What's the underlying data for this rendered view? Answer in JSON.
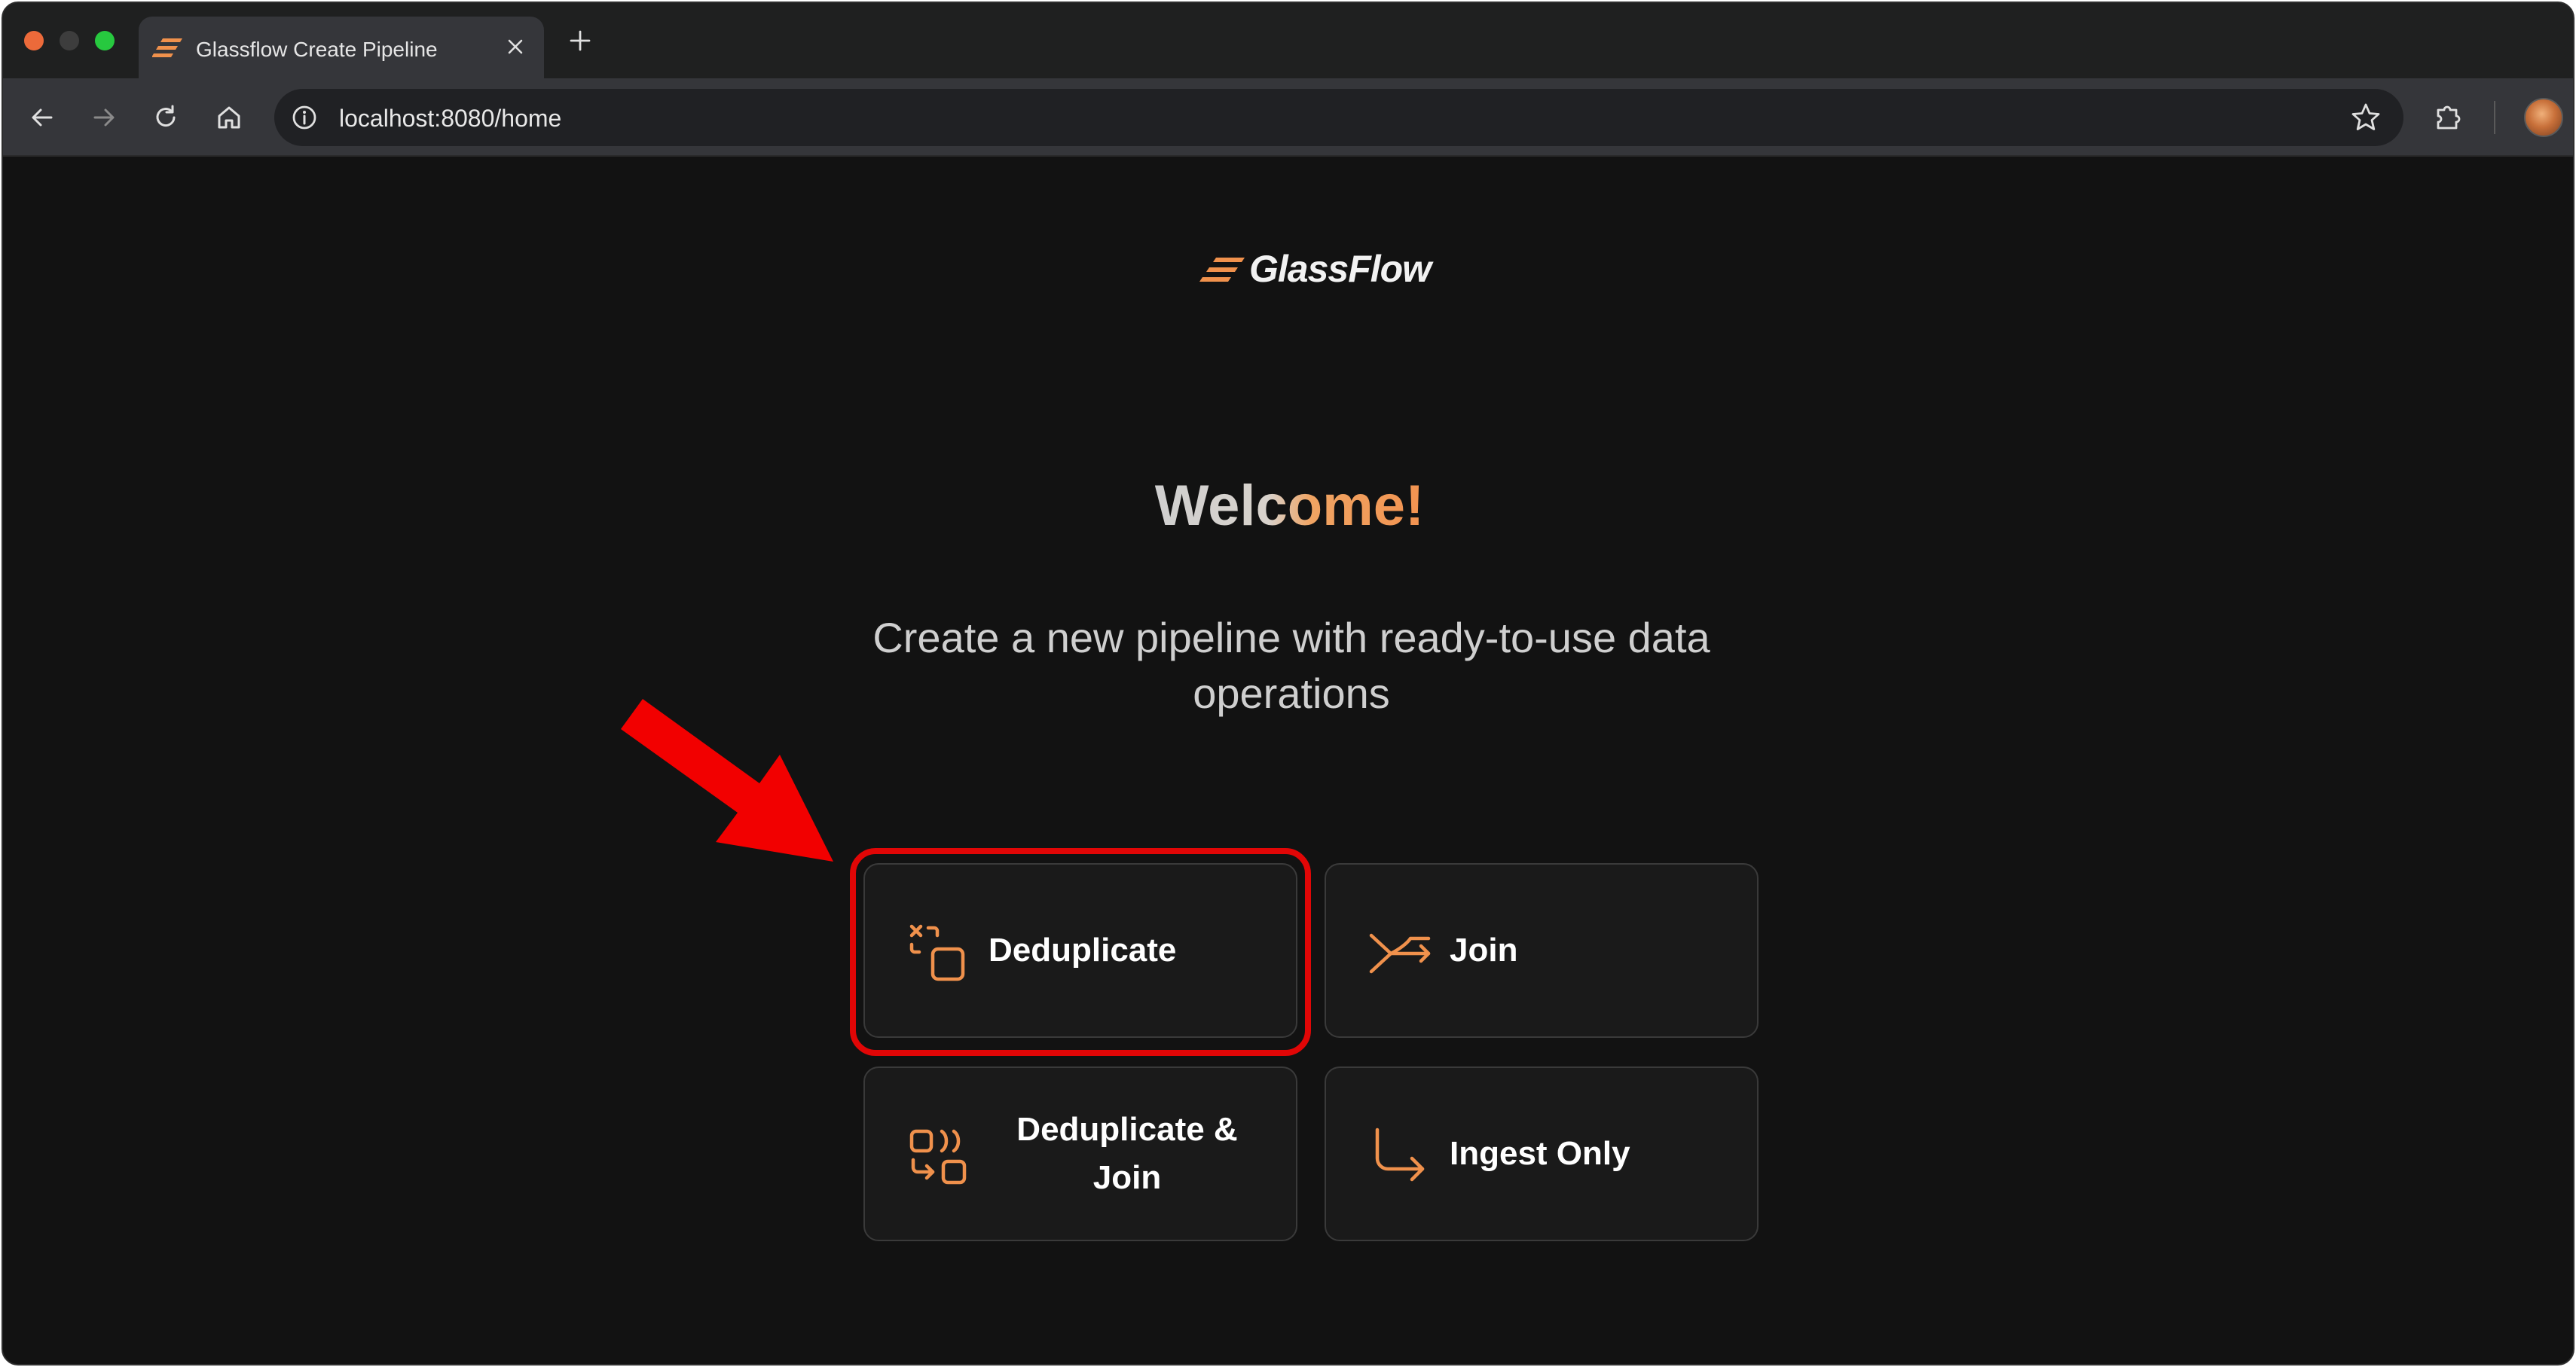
{
  "browser": {
    "tab_title": "Glassflow Create Pipeline",
    "url": "localhost:8080/home",
    "icons": {
      "back": "arrow-left-icon",
      "forward": "arrow-right-icon",
      "reload": "reload-icon",
      "home": "home-icon",
      "info": "info-icon",
      "bookmark": "star-icon",
      "extensions": "puzzle-icon",
      "new_tab": "plus-icon",
      "close_tab": "close-icon"
    }
  },
  "brand": {
    "name": "GlassFlow",
    "accent_color": "#F0914C"
  },
  "hero": {
    "title": "Welcome!",
    "subtitle": "Create a new pipeline with ready-to-use data operations"
  },
  "options": [
    {
      "label": "Deduplicate",
      "icon": "deduplicate-icon",
      "highlighted": true
    },
    {
      "label": "Join",
      "icon": "join-icon"
    },
    {
      "label": "Deduplicate & Join",
      "icon": "deduplicate-join-icon"
    },
    {
      "label": "Ingest Only",
      "icon": "ingest-icon"
    }
  ],
  "annotation": {
    "color": "#E10606",
    "target": "Deduplicate"
  }
}
